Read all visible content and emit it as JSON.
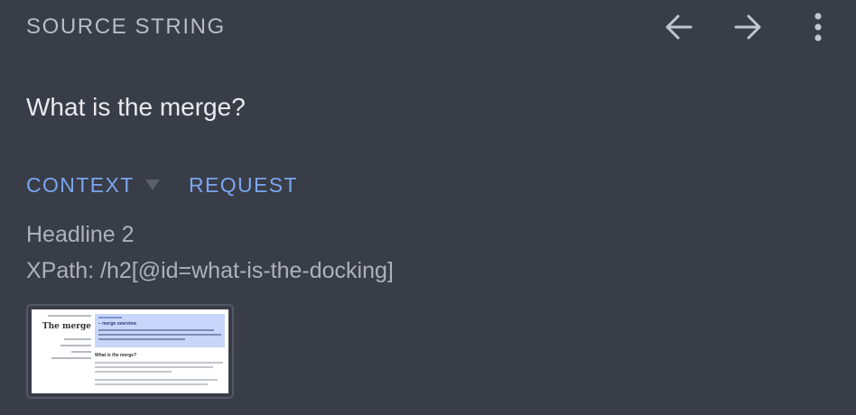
{
  "header": {
    "title": "SOURCE STRING",
    "actions": [
      {
        "name": "back",
        "icon": "arrow-left-icon"
      },
      {
        "name": "forward",
        "icon": "arrow-right-icon"
      },
      {
        "name": "more",
        "icon": "more-vertical-icon"
      }
    ]
  },
  "source": {
    "text": "What is the merge?"
  },
  "tabs": [
    {
      "label": "CONTEXT",
      "has_dropdown": true,
      "active": true
    },
    {
      "label": "REQUEST",
      "has_dropdown": false,
      "active": false
    }
  ],
  "context": {
    "element_type": "Headline 2",
    "xpath": "XPath: /h2[@id=what-is-the-docking]"
  },
  "screenshot_thumbnail": {
    "page_title": "The merge",
    "hero_heading": "– ️‍merge overview",
    "section_heading": "What is the merge?"
  },
  "colors": {
    "background": "#393d48",
    "accent": "#7aa6ef",
    "text_primary": "#e9eaee",
    "text_secondary": "#aeb1b9"
  }
}
